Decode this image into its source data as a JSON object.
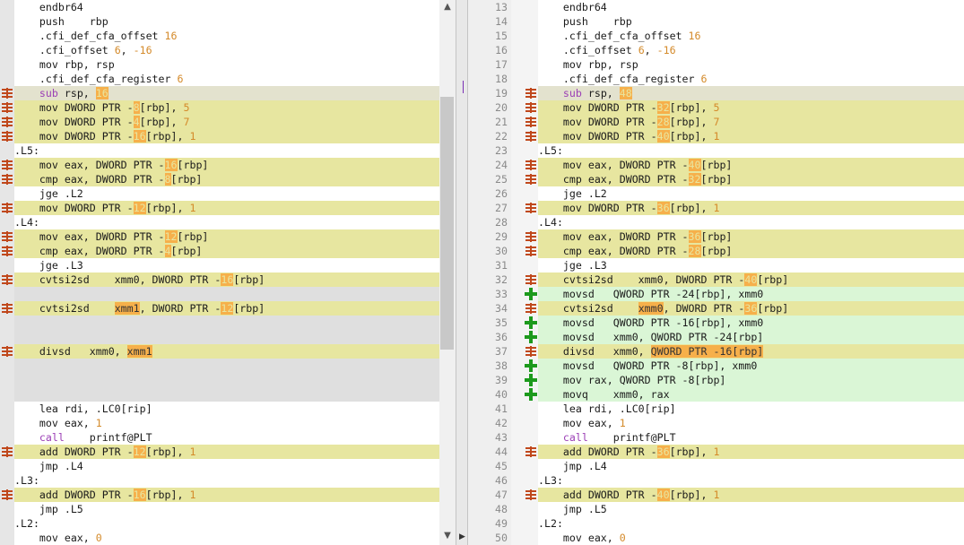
{
  "left_lines": [
    {
      "t": "plain",
      "segs": [
        [
          "p",
          "    endbr64"
        ]
      ]
    },
    {
      "t": "plain",
      "segs": [
        [
          "p",
          "    push    rbp"
        ]
      ]
    },
    {
      "t": "plain",
      "segs": [
        [
          "p",
          "    .cfi_def_cfa_offset "
        ],
        [
          "n",
          "16"
        ]
      ]
    },
    {
      "t": "plain",
      "segs": [
        [
          "p",
          "    .cfi_offset "
        ],
        [
          "n",
          "6"
        ],
        [
          "p",
          ", "
        ],
        [
          "n",
          "-16"
        ]
      ]
    },
    {
      "t": "plain",
      "segs": [
        [
          "p",
          "    mov rbp, rsp"
        ]
      ]
    },
    {
      "t": "plain",
      "segs": [
        [
          "p",
          "    .cfi_def_cfa_register "
        ],
        [
          "n",
          "6"
        ]
      ]
    },
    {
      "t": "cur",
      "m": "eq",
      "segs": [
        [
          "k",
          "    sub"
        ],
        [
          "p",
          " rsp, "
        ],
        [
          "d",
          "16"
        ]
      ]
    },
    {
      "t": "chg",
      "m": "eq",
      "segs": [
        [
          "p",
          "    mov DWORD PTR -"
        ],
        [
          "d",
          "8"
        ],
        [
          "p",
          "[rbp], "
        ],
        [
          "n",
          "5"
        ]
      ]
    },
    {
      "t": "chg",
      "m": "eq",
      "segs": [
        [
          "p",
          "    mov DWORD PTR -"
        ],
        [
          "d",
          "4"
        ],
        [
          "p",
          "[rbp], "
        ],
        [
          "n",
          "7"
        ]
      ]
    },
    {
      "t": "chg",
      "m": "eq",
      "segs": [
        [
          "p",
          "    mov DWORD PTR -"
        ],
        [
          "d",
          "16"
        ],
        [
          "p",
          "[rbp], "
        ],
        [
          "n",
          "1"
        ]
      ]
    },
    {
      "t": "plain",
      "segs": [
        [
          "p",
          ".L5:"
        ]
      ]
    },
    {
      "t": "chg",
      "m": "eq",
      "segs": [
        [
          "p",
          "    mov eax, DWORD PTR -"
        ],
        [
          "d",
          "16"
        ],
        [
          "p",
          "[rbp]"
        ]
      ]
    },
    {
      "t": "chg",
      "m": "eq",
      "segs": [
        [
          "p",
          "    cmp eax, DWORD PTR -"
        ],
        [
          "d",
          "8"
        ],
        [
          "p",
          "[rbp]"
        ]
      ]
    },
    {
      "t": "plain",
      "segs": [
        [
          "p",
          "    jge .L2"
        ]
      ]
    },
    {
      "t": "chg",
      "m": "eq",
      "segs": [
        [
          "p",
          "    mov DWORD PTR -"
        ],
        [
          "d",
          "12"
        ],
        [
          "p",
          "[rbp], "
        ],
        [
          "n",
          "1"
        ]
      ]
    },
    {
      "t": "plain",
      "segs": [
        [
          "p",
          ".L4:"
        ]
      ]
    },
    {
      "t": "chg",
      "m": "eq",
      "segs": [
        [
          "p",
          "    mov eax, DWORD PTR -"
        ],
        [
          "d",
          "12"
        ],
        [
          "p",
          "[rbp]"
        ]
      ]
    },
    {
      "t": "chg",
      "m": "eq",
      "segs": [
        [
          "p",
          "    cmp eax, DWORD PTR -"
        ],
        [
          "d",
          "4"
        ],
        [
          "p",
          "[rbp]"
        ]
      ]
    },
    {
      "t": "plain",
      "segs": [
        [
          "p",
          "    jge .L3"
        ]
      ]
    },
    {
      "t": "chg",
      "m": "eq",
      "segs": [
        [
          "p",
          "    cvtsi2sd    xmm0, DWORD PTR -"
        ],
        [
          "d",
          "16"
        ],
        [
          "p",
          "[rbp]"
        ]
      ]
    },
    {
      "t": "gap",
      "segs": []
    },
    {
      "t": "chg",
      "m": "eq",
      "segs": [
        [
          "p",
          "    cvtsi2sd    "
        ],
        [
          "d2",
          "xmm1"
        ],
        [
          "p",
          ", DWORD PTR -"
        ],
        [
          "d",
          "12"
        ],
        [
          "p",
          "[rbp]"
        ]
      ]
    },
    {
      "t": "gap",
      "segs": []
    },
    {
      "t": "gap",
      "segs": []
    },
    {
      "t": "chg",
      "m": "eq",
      "segs": [
        [
          "p",
          "    divsd   xmm0, "
        ],
        [
          "d2",
          "xmm1"
        ]
      ]
    },
    {
      "t": "gap",
      "segs": []
    },
    {
      "t": "gap",
      "segs": []
    },
    {
      "t": "gap",
      "segs": []
    },
    {
      "t": "plain",
      "segs": [
        [
          "p",
          "    lea rdi, .LC0[rip]"
        ]
      ]
    },
    {
      "t": "plain",
      "segs": [
        [
          "p",
          "    mov eax, "
        ],
        [
          "n",
          "1"
        ]
      ]
    },
    {
      "t": "plain",
      "segs": [
        [
          "k",
          "    call"
        ],
        [
          "p",
          "    printf@PLT"
        ]
      ]
    },
    {
      "t": "chg",
      "m": "eq",
      "segs": [
        [
          "p",
          "    add DWORD PTR -"
        ],
        [
          "d",
          "12"
        ],
        [
          "p",
          "[rbp], "
        ],
        [
          "n",
          "1"
        ]
      ]
    },
    {
      "t": "plain",
      "segs": [
        [
          "p",
          "    jmp .L4"
        ]
      ]
    },
    {
      "t": "plain",
      "segs": [
        [
          "p",
          ".L3:"
        ]
      ]
    },
    {
      "t": "chg",
      "m": "eq",
      "segs": [
        [
          "p",
          "    add DWORD PTR -"
        ],
        [
          "d",
          "16"
        ],
        [
          "p",
          "[rbp], "
        ],
        [
          "n",
          "1"
        ]
      ]
    },
    {
      "t": "plain",
      "segs": [
        [
          "p",
          "    jmp .L5"
        ]
      ]
    },
    {
      "t": "plain",
      "segs": [
        [
          "p",
          ".L2:"
        ]
      ]
    },
    {
      "t": "plain",
      "segs": [
        [
          "p",
          "    mov eax, "
        ],
        [
          "n",
          "0"
        ]
      ]
    }
  ],
  "right_lines": [
    {
      "n": "13",
      "t": "plain",
      "segs": [
        [
          "p",
          "    endbr64"
        ]
      ]
    },
    {
      "n": "14",
      "t": "plain",
      "segs": [
        [
          "p",
          "    push    rbp"
        ]
      ]
    },
    {
      "n": "15",
      "t": "plain",
      "segs": [
        [
          "p",
          "    .cfi_def_cfa_offset "
        ],
        [
          "n",
          "16"
        ]
      ]
    },
    {
      "n": "16",
      "t": "plain",
      "segs": [
        [
          "p",
          "    .cfi_offset "
        ],
        [
          "n",
          "6"
        ],
        [
          "p",
          ", "
        ],
        [
          "n",
          "-16"
        ]
      ]
    },
    {
      "n": "17",
      "t": "plain",
      "segs": [
        [
          "p",
          "    mov rbp, rsp"
        ]
      ]
    },
    {
      "n": "18",
      "t": "plain",
      "segs": [
        [
          "p",
          "    .cfi_def_cfa_register "
        ],
        [
          "n",
          "6"
        ]
      ]
    },
    {
      "n": "19",
      "t": "cur",
      "m": "eq",
      "segs": [
        [
          "k",
          "    sub"
        ],
        [
          "p",
          " rsp, "
        ],
        [
          "d",
          "48"
        ]
      ]
    },
    {
      "n": "20",
      "t": "chg",
      "m": "eq",
      "segs": [
        [
          "p",
          "    mov DWORD PTR -"
        ],
        [
          "d",
          "32"
        ],
        [
          "p",
          "[rbp], "
        ],
        [
          "n",
          "5"
        ]
      ]
    },
    {
      "n": "21",
      "t": "chg",
      "m": "eq",
      "segs": [
        [
          "p",
          "    mov DWORD PTR -"
        ],
        [
          "d",
          "28"
        ],
        [
          "p",
          "[rbp], "
        ],
        [
          "n",
          "7"
        ]
      ]
    },
    {
      "n": "22",
      "t": "chg",
      "m": "eq",
      "segs": [
        [
          "p",
          "    mov DWORD PTR -"
        ],
        [
          "d",
          "40"
        ],
        [
          "p",
          "[rbp], "
        ],
        [
          "n",
          "1"
        ]
      ]
    },
    {
      "n": "23",
      "t": "plain",
      "segs": [
        [
          "p",
          ".L5:"
        ]
      ]
    },
    {
      "n": "24",
      "t": "chg",
      "m": "eq",
      "segs": [
        [
          "p",
          "    mov eax, DWORD PTR -"
        ],
        [
          "d",
          "40"
        ],
        [
          "p",
          "[rbp]"
        ]
      ]
    },
    {
      "n": "25",
      "t": "chg",
      "m": "eq",
      "segs": [
        [
          "p",
          "    cmp eax, DWORD PTR -"
        ],
        [
          "d",
          "32"
        ],
        [
          "p",
          "[rbp]"
        ]
      ]
    },
    {
      "n": "26",
      "t": "plain",
      "segs": [
        [
          "p",
          "    jge .L2"
        ]
      ]
    },
    {
      "n": "27",
      "t": "chg",
      "m": "eq",
      "segs": [
        [
          "p",
          "    mov DWORD PTR -"
        ],
        [
          "d",
          "36"
        ],
        [
          "p",
          "[rbp], "
        ],
        [
          "n",
          "1"
        ]
      ]
    },
    {
      "n": "28",
      "t": "plain",
      "segs": [
        [
          "p",
          ".L4:"
        ]
      ]
    },
    {
      "n": "29",
      "t": "chg",
      "m": "eq",
      "segs": [
        [
          "p",
          "    mov eax, DWORD PTR -"
        ],
        [
          "d",
          "36"
        ],
        [
          "p",
          "[rbp]"
        ]
      ]
    },
    {
      "n": "30",
      "t": "chg",
      "m": "eq",
      "segs": [
        [
          "p",
          "    cmp eax, DWORD PTR -"
        ],
        [
          "d",
          "28"
        ],
        [
          "p",
          "[rbp]"
        ]
      ]
    },
    {
      "n": "31",
      "t": "plain",
      "segs": [
        [
          "p",
          "    jge .L3"
        ]
      ]
    },
    {
      "n": "32",
      "t": "chg",
      "m": "eq",
      "segs": [
        [
          "p",
          "    cvtsi2sd    xmm0, DWORD PTR -"
        ],
        [
          "d",
          "40"
        ],
        [
          "p",
          "[rbp]"
        ]
      ]
    },
    {
      "n": "33",
      "t": "add",
      "m": "plus",
      "segs": [
        [
          "p",
          "    movsd   QWORD PTR -24[rbp], xmm0"
        ]
      ]
    },
    {
      "n": "34",
      "t": "chg",
      "m": "eq",
      "segs": [
        [
          "p",
          "    cvtsi2sd    "
        ],
        [
          "d2",
          "xmm0"
        ],
        [
          "p",
          ", DWORD PTR -"
        ],
        [
          "d",
          "36"
        ],
        [
          "p",
          "[rbp]"
        ]
      ]
    },
    {
      "n": "35",
      "t": "add",
      "m": "plus",
      "segs": [
        [
          "p",
          "    movsd   QWORD PTR -16[rbp], xmm0"
        ]
      ]
    },
    {
      "n": "36",
      "t": "add",
      "m": "plus",
      "segs": [
        [
          "p",
          "    movsd   xmm0, QWORD PTR -24[rbp]"
        ]
      ]
    },
    {
      "n": "37",
      "t": "chg",
      "m": "eq",
      "segs": [
        [
          "p",
          "    divsd   xmm0, "
        ],
        [
          "d2",
          "QWORD PTR -16[rbp]"
        ]
      ]
    },
    {
      "n": "38",
      "t": "add",
      "m": "plus",
      "segs": [
        [
          "p",
          "    movsd   QWORD PTR -8[rbp], xmm0"
        ]
      ]
    },
    {
      "n": "39",
      "t": "add",
      "m": "plus",
      "segs": [
        [
          "p",
          "    mov rax, QWORD PTR -8[rbp]"
        ]
      ]
    },
    {
      "n": "40",
      "t": "add",
      "m": "plus",
      "segs": [
        [
          "p",
          "    movq    xmm0, rax"
        ]
      ]
    },
    {
      "n": "41",
      "t": "plain",
      "segs": [
        [
          "p",
          "    lea rdi, .LC0[rip]"
        ]
      ]
    },
    {
      "n": "42",
      "t": "plain",
      "segs": [
        [
          "p",
          "    mov eax, "
        ],
        [
          "n",
          "1"
        ]
      ]
    },
    {
      "n": "43",
      "t": "plain",
      "segs": [
        [
          "k",
          "    call"
        ],
        [
          "p",
          "    printf@PLT"
        ]
      ]
    },
    {
      "n": "44",
      "t": "chg",
      "m": "eq",
      "segs": [
        [
          "p",
          "    add DWORD PTR -"
        ],
        [
          "d",
          "36"
        ],
        [
          "p",
          "[rbp], "
        ],
        [
          "n",
          "1"
        ]
      ]
    },
    {
      "n": "45",
      "t": "plain",
      "segs": [
        [
          "p",
          "    jmp .L4"
        ]
      ]
    },
    {
      "n": "46",
      "t": "plain",
      "segs": [
        [
          "p",
          ".L3:"
        ]
      ]
    },
    {
      "n": "47",
      "t": "chg",
      "m": "eq",
      "segs": [
        [
          "p",
          "    add DWORD PTR -"
        ],
        [
          "d",
          "40"
        ],
        [
          "p",
          "[rbp], "
        ],
        [
          "n",
          "1"
        ]
      ]
    },
    {
      "n": "48",
      "t": "plain",
      "segs": [
        [
          "p",
          "    jmp .L5"
        ]
      ]
    },
    {
      "n": "49",
      "t": "plain",
      "segs": [
        [
          "p",
          ".L2:"
        ]
      ]
    },
    {
      "n": "50",
      "t": "plain",
      "segs": [
        [
          "p",
          "    mov eax, "
        ],
        [
          "n",
          "0"
        ]
      ]
    }
  ],
  "icons": {
    "changed_marker": "changed-line-icon",
    "added_marker": "added-line-icon",
    "scroll_up": "▲",
    "scroll_down": "▼",
    "sync_arrow": "▶"
  },
  "colors": {
    "changed_bg": "#e7e6a0",
    "added_bg": "#daf6d6",
    "diff_highlight": "#f6b04b",
    "number": "#d48a2a",
    "keyword": "#9b3fb6"
  }
}
